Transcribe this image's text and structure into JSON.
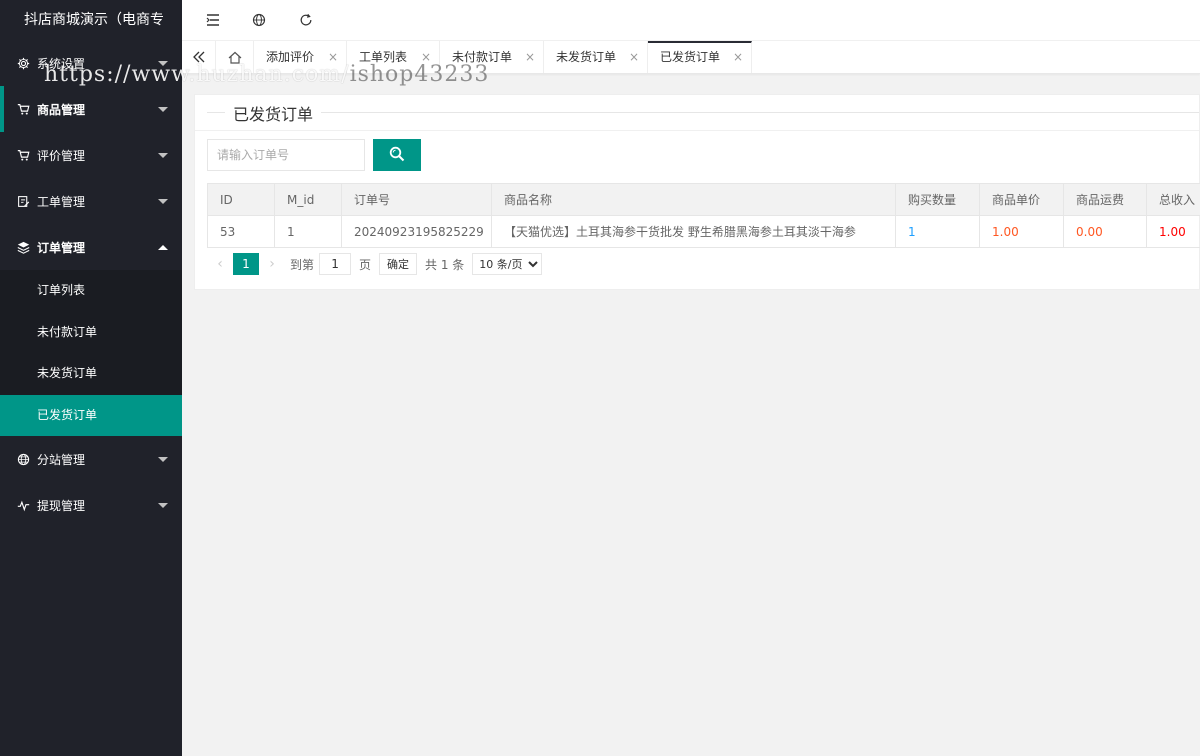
{
  "app": {
    "title": "抖店商城演示（电商专"
  },
  "sidebar": {
    "items": [
      {
        "label": "系统设置",
        "icon": "gear-icon"
      },
      {
        "label": "商品管理",
        "icon": "cart-icon"
      },
      {
        "label": "评价管理",
        "icon": "cart-icon"
      },
      {
        "label": "工单管理",
        "icon": "edit-icon"
      },
      {
        "label": "订单管理",
        "icon": "layers-icon"
      },
      {
        "label": "分站管理",
        "icon": "globe-icon"
      },
      {
        "label": "提现管理",
        "icon": "pulse-icon"
      }
    ],
    "order_submenu": [
      "订单列表",
      "未付款订单",
      "未发货订单",
      "已发货订单"
    ]
  },
  "header": {
    "icons": [
      "collapse-icon",
      "globe-icon",
      "refresh-icon"
    ]
  },
  "tabs": [
    {
      "label": "添加评价"
    },
    {
      "label": "工单列表"
    },
    {
      "label": "未付款订单"
    },
    {
      "label": "未发货订单"
    },
    {
      "label": "已发货订单",
      "active": true
    }
  ],
  "tab_close": "×",
  "page": {
    "title": "已发货订单",
    "search": {
      "placeholder": "请输入订单号",
      "value": ""
    }
  },
  "table": {
    "columns": [
      "ID",
      "M_id",
      "订单号",
      "商品名称",
      "购买数量",
      "商品单价",
      "商品运费",
      "总收入"
    ],
    "rows": [
      [
        "53",
        "1",
        "20240923195825229",
        "【天猫优选】土耳其海参干货批发 野生希腊黑海参土耳其淡干海参",
        "1",
        "1.00",
        "0.00",
        "1.00"
      ]
    ]
  },
  "pager": {
    "prev": "‹",
    "next": "›",
    "current": "1",
    "goto_label": "到第",
    "goto_value": "1",
    "page_unit": "页",
    "confirm": "确定",
    "total": "共 1 条",
    "page_size": "10 条/页"
  },
  "watermark": {
    "part1": "https://www.huzhan.com/",
    "part2": "ishop43233"
  },
  "colors": {
    "sidebar": "#20222a",
    "accent": "#009688",
    "blue": "#1e9fff",
    "orange": "#ff5722",
    "red": "#ff0000"
  }
}
